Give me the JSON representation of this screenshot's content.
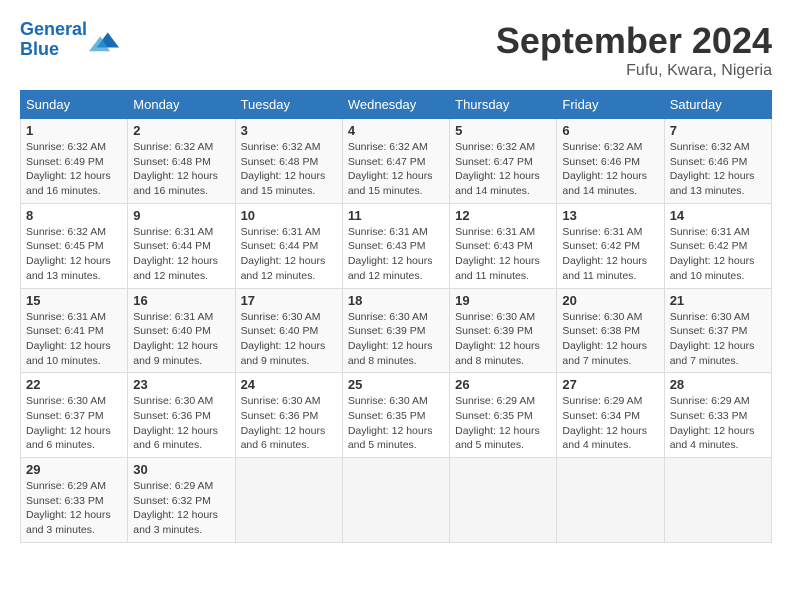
{
  "header": {
    "logo_line1": "General",
    "logo_line2": "Blue",
    "month_title": "September 2024",
    "location": "Fufu, Kwara, Nigeria"
  },
  "columns": [
    "Sunday",
    "Monday",
    "Tuesday",
    "Wednesday",
    "Thursday",
    "Friday",
    "Saturday"
  ],
  "weeks": [
    [
      {
        "day": "1",
        "sunrise": "6:32 AM",
        "sunset": "6:49 PM",
        "daylight": "12 hours and 16 minutes."
      },
      {
        "day": "2",
        "sunrise": "6:32 AM",
        "sunset": "6:48 PM",
        "daylight": "12 hours and 16 minutes."
      },
      {
        "day": "3",
        "sunrise": "6:32 AM",
        "sunset": "6:48 PM",
        "daylight": "12 hours and 15 minutes."
      },
      {
        "day": "4",
        "sunrise": "6:32 AM",
        "sunset": "6:47 PM",
        "daylight": "12 hours and 15 minutes."
      },
      {
        "day": "5",
        "sunrise": "6:32 AM",
        "sunset": "6:47 PM",
        "daylight": "12 hours and 14 minutes."
      },
      {
        "day": "6",
        "sunrise": "6:32 AM",
        "sunset": "6:46 PM",
        "daylight": "12 hours and 14 minutes."
      },
      {
        "day": "7",
        "sunrise": "6:32 AM",
        "sunset": "6:46 PM",
        "daylight": "12 hours and 13 minutes."
      }
    ],
    [
      {
        "day": "8",
        "sunrise": "6:32 AM",
        "sunset": "6:45 PM",
        "daylight": "12 hours and 13 minutes."
      },
      {
        "day": "9",
        "sunrise": "6:31 AM",
        "sunset": "6:44 PM",
        "daylight": "12 hours and 12 minutes."
      },
      {
        "day": "10",
        "sunrise": "6:31 AM",
        "sunset": "6:44 PM",
        "daylight": "12 hours and 12 minutes."
      },
      {
        "day": "11",
        "sunrise": "6:31 AM",
        "sunset": "6:43 PM",
        "daylight": "12 hours and 12 minutes."
      },
      {
        "day": "12",
        "sunrise": "6:31 AM",
        "sunset": "6:43 PM",
        "daylight": "12 hours and 11 minutes."
      },
      {
        "day": "13",
        "sunrise": "6:31 AM",
        "sunset": "6:42 PM",
        "daylight": "12 hours and 11 minutes."
      },
      {
        "day": "14",
        "sunrise": "6:31 AM",
        "sunset": "6:42 PM",
        "daylight": "12 hours and 10 minutes."
      }
    ],
    [
      {
        "day": "15",
        "sunrise": "6:31 AM",
        "sunset": "6:41 PM",
        "daylight": "12 hours and 10 minutes."
      },
      {
        "day": "16",
        "sunrise": "6:31 AM",
        "sunset": "6:40 PM",
        "daylight": "12 hours and 9 minutes."
      },
      {
        "day": "17",
        "sunrise": "6:30 AM",
        "sunset": "6:40 PM",
        "daylight": "12 hours and 9 minutes."
      },
      {
        "day": "18",
        "sunrise": "6:30 AM",
        "sunset": "6:39 PM",
        "daylight": "12 hours and 8 minutes."
      },
      {
        "day": "19",
        "sunrise": "6:30 AM",
        "sunset": "6:39 PM",
        "daylight": "12 hours and 8 minutes."
      },
      {
        "day": "20",
        "sunrise": "6:30 AM",
        "sunset": "6:38 PM",
        "daylight": "12 hours and 7 minutes."
      },
      {
        "day": "21",
        "sunrise": "6:30 AM",
        "sunset": "6:37 PM",
        "daylight": "12 hours and 7 minutes."
      }
    ],
    [
      {
        "day": "22",
        "sunrise": "6:30 AM",
        "sunset": "6:37 PM",
        "daylight": "12 hours and 6 minutes."
      },
      {
        "day": "23",
        "sunrise": "6:30 AM",
        "sunset": "6:36 PM",
        "daylight": "12 hours and 6 minutes."
      },
      {
        "day": "24",
        "sunrise": "6:30 AM",
        "sunset": "6:36 PM",
        "daylight": "12 hours and 6 minutes."
      },
      {
        "day": "25",
        "sunrise": "6:30 AM",
        "sunset": "6:35 PM",
        "daylight": "12 hours and 5 minutes."
      },
      {
        "day": "26",
        "sunrise": "6:29 AM",
        "sunset": "6:35 PM",
        "daylight": "12 hours and 5 minutes."
      },
      {
        "day": "27",
        "sunrise": "6:29 AM",
        "sunset": "6:34 PM",
        "daylight": "12 hours and 4 minutes."
      },
      {
        "day": "28",
        "sunrise": "6:29 AM",
        "sunset": "6:33 PM",
        "daylight": "12 hours and 4 minutes."
      }
    ],
    [
      {
        "day": "29",
        "sunrise": "6:29 AM",
        "sunset": "6:33 PM",
        "daylight": "12 hours and 3 minutes."
      },
      {
        "day": "30",
        "sunrise": "6:29 AM",
        "sunset": "6:32 PM",
        "daylight": "12 hours and 3 minutes."
      },
      null,
      null,
      null,
      null,
      null
    ]
  ]
}
